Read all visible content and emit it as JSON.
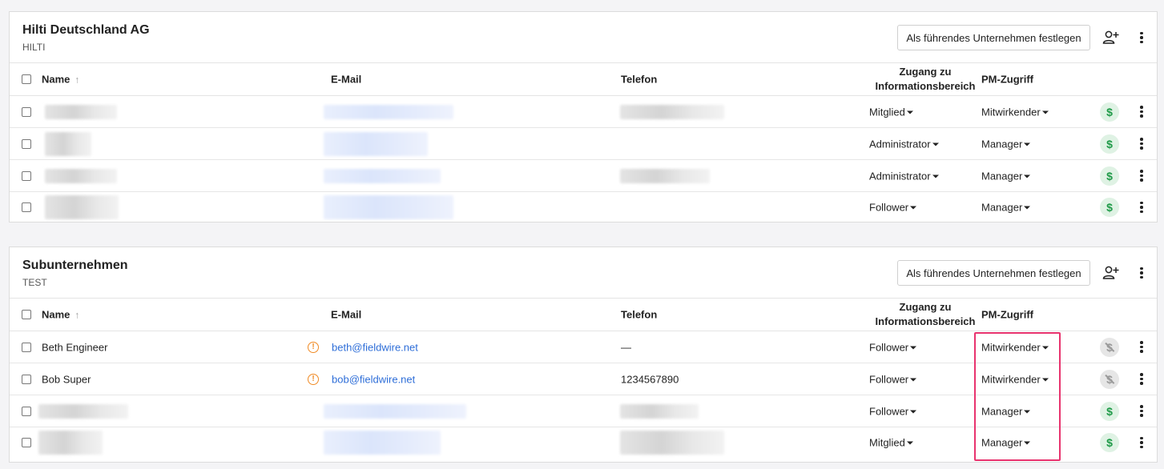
{
  "table_headers": {
    "name": "Name",
    "email": "E-Mail",
    "phone": "Telefon",
    "zugang": "Zugang zu Informationsbereich",
    "pm": "PM-Zugriff"
  },
  "lead_button_label": "Als führendes Unternehmen festlegen",
  "companies": [
    {
      "name": "Hilti Deutschland AG",
      "code": "HILTI",
      "rows": [
        {
          "name": "",
          "email": "",
          "phone": "",
          "zugang": "Mitglied",
          "pm": "Mitwirkender",
          "payment": "enabled"
        },
        {
          "name": "",
          "email": "",
          "phone": "",
          "zugang": "Administrator",
          "pm": "Manager",
          "payment": "enabled"
        },
        {
          "name": "",
          "email": "",
          "phone": "",
          "zugang": "Administrator",
          "pm": "Manager",
          "payment": "enabled"
        },
        {
          "name": "",
          "email": "",
          "phone": "",
          "zugang": "Follower",
          "pm": "Manager",
          "payment": "enabled"
        }
      ]
    },
    {
      "name": "Subunternehmen",
      "code": "TEST",
      "rows": [
        {
          "name": "Beth Engineer",
          "email": "beth@fieldwire.net",
          "phone": "—",
          "zugang": "Follower",
          "pm": "Mitwirkender",
          "payment": "disabled",
          "warning": true
        },
        {
          "name": "Bob Super",
          "email": "bob@fieldwire.net",
          "phone": "1234567890",
          "zugang": "Follower",
          "pm": "Mitwirkender",
          "payment": "disabled",
          "warning": true
        },
        {
          "name": "",
          "email": "",
          "phone": "",
          "zugang": "Follower",
          "pm": "Manager",
          "payment": "enabled"
        },
        {
          "name": "",
          "email": "",
          "phone": "",
          "zugang": "Mitglied",
          "pm": "Manager",
          "payment": "enabled"
        }
      ]
    }
  ],
  "icons": {
    "sort": "arrow-up-icon",
    "warning": "warning-circle-icon",
    "payment": "dollar-icon",
    "add_user": "add-user-icon",
    "more": "kebab-menu-icon"
  },
  "colors": {
    "link": "#2e6ed8",
    "warning": "#f08a24",
    "payment_on": "#1f9a48",
    "highlight": "#e8336e"
  }
}
